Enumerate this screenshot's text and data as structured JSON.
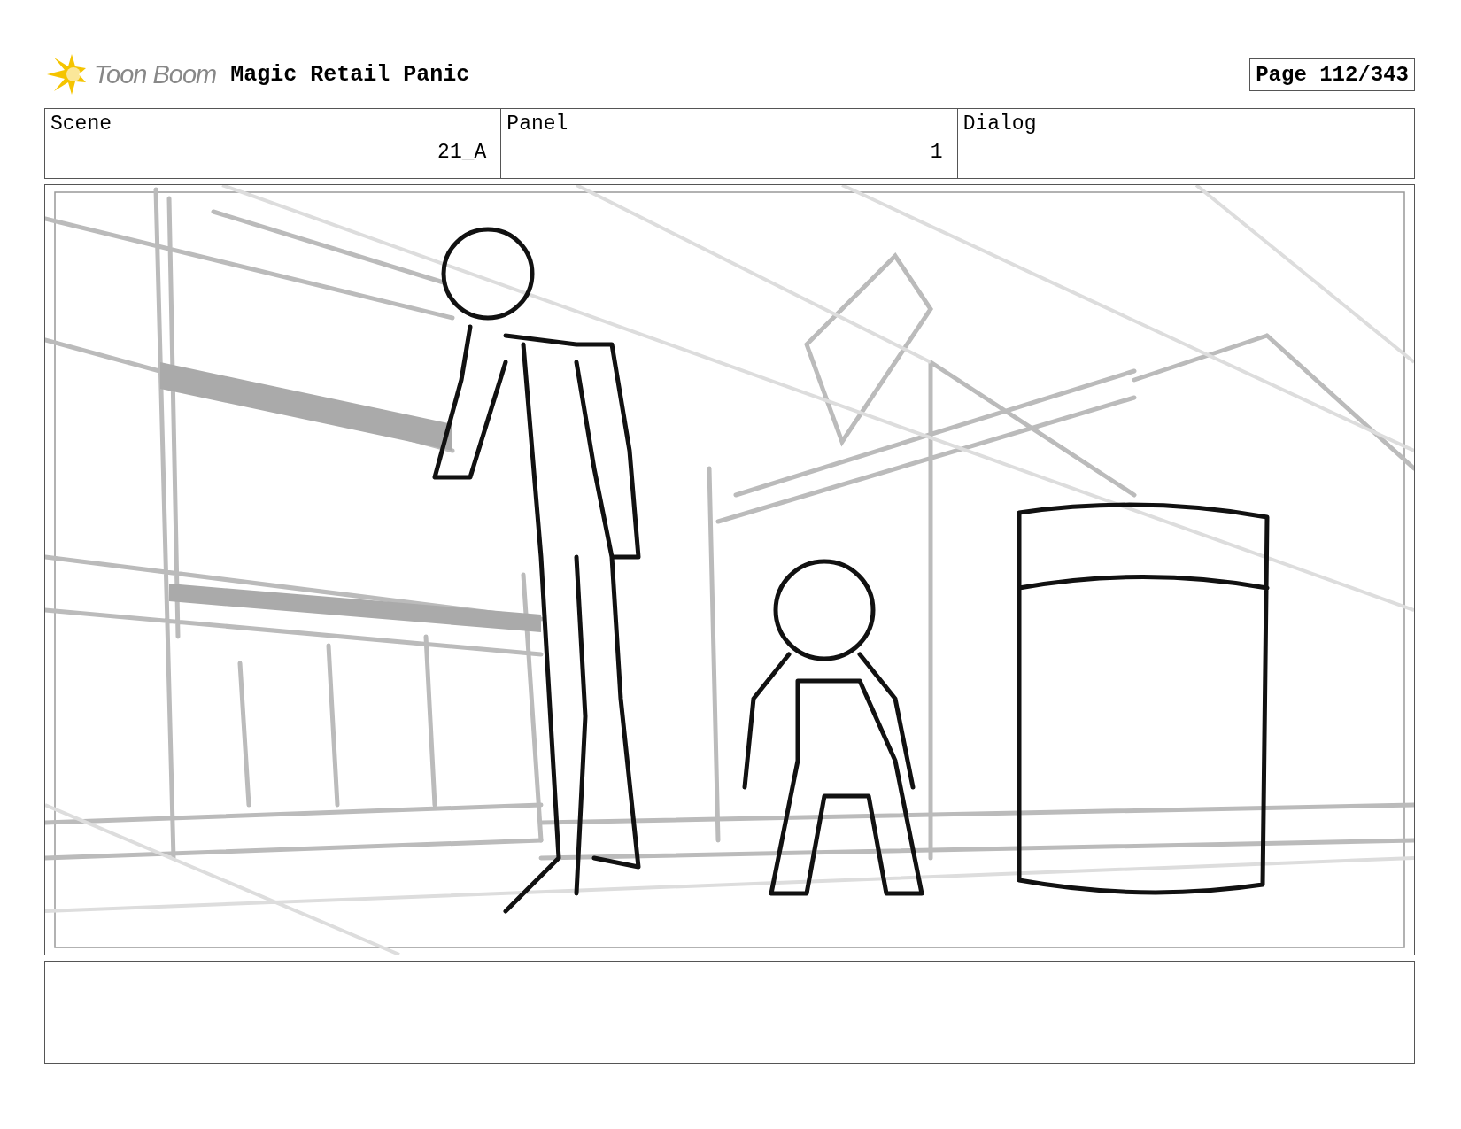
{
  "header": {
    "logo_text": "Toon Boom",
    "project_title": "Magic Retail Panic",
    "page": "Page 112/343"
  },
  "fields": [
    {
      "label": "Scene",
      "value": "21_A"
    },
    {
      "label": "Panel",
      "value": "1"
    },
    {
      "label": "Dialog"
    }
  ]
}
